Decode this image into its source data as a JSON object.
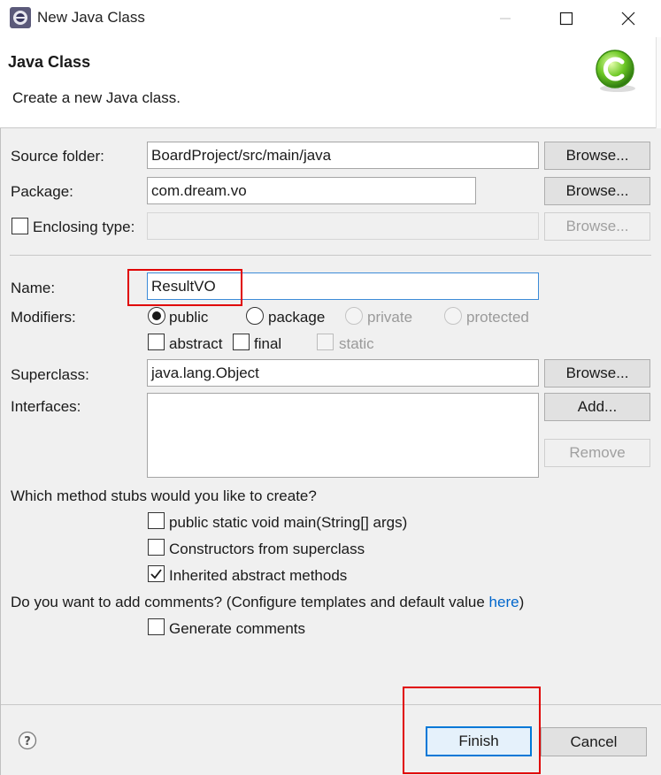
{
  "window": {
    "title": "New Java Class"
  },
  "header": {
    "title": "Java Class",
    "description": "Create a new Java class."
  },
  "source_folder": {
    "label": "Source folder:",
    "value": "BoardProject/src/main/java",
    "browse": "Browse..."
  },
  "package": {
    "label": "Package:",
    "value": "com.dream.vo",
    "browse": "Browse..."
  },
  "enclosing": {
    "label": "Enclosing type:",
    "value": "",
    "checked": false,
    "browse": "Browse..."
  },
  "name": {
    "label": "Name:",
    "value": "ResultVO"
  },
  "modifiers": {
    "label": "Modifiers:",
    "options": [
      "public",
      "package",
      "private",
      "protected"
    ],
    "selected": "public",
    "flags": [
      "abstract",
      "final",
      "static"
    ]
  },
  "superclass": {
    "label": "Superclass:",
    "value": "java.lang.Object",
    "browse": "Browse..."
  },
  "interfaces": {
    "label": "Interfaces:",
    "add": "Add...",
    "remove": "Remove"
  },
  "stubs": {
    "question": "Which method stubs would you like to create?",
    "items": [
      {
        "label": "public static void main(String[] args)",
        "checked": false
      },
      {
        "label": "Constructors from superclass",
        "checked": false
      },
      {
        "label": "Inherited abstract methods",
        "checked": true
      }
    ]
  },
  "comments": {
    "question_prefix": "Do you want to add comments? (Configure templates and default value ",
    "link": "here",
    "question_suffix": ")",
    "generate_label": "Generate comments",
    "checked": false
  },
  "footer": {
    "help_icon": "help-icon",
    "finish": "Finish",
    "cancel": "Cancel"
  }
}
